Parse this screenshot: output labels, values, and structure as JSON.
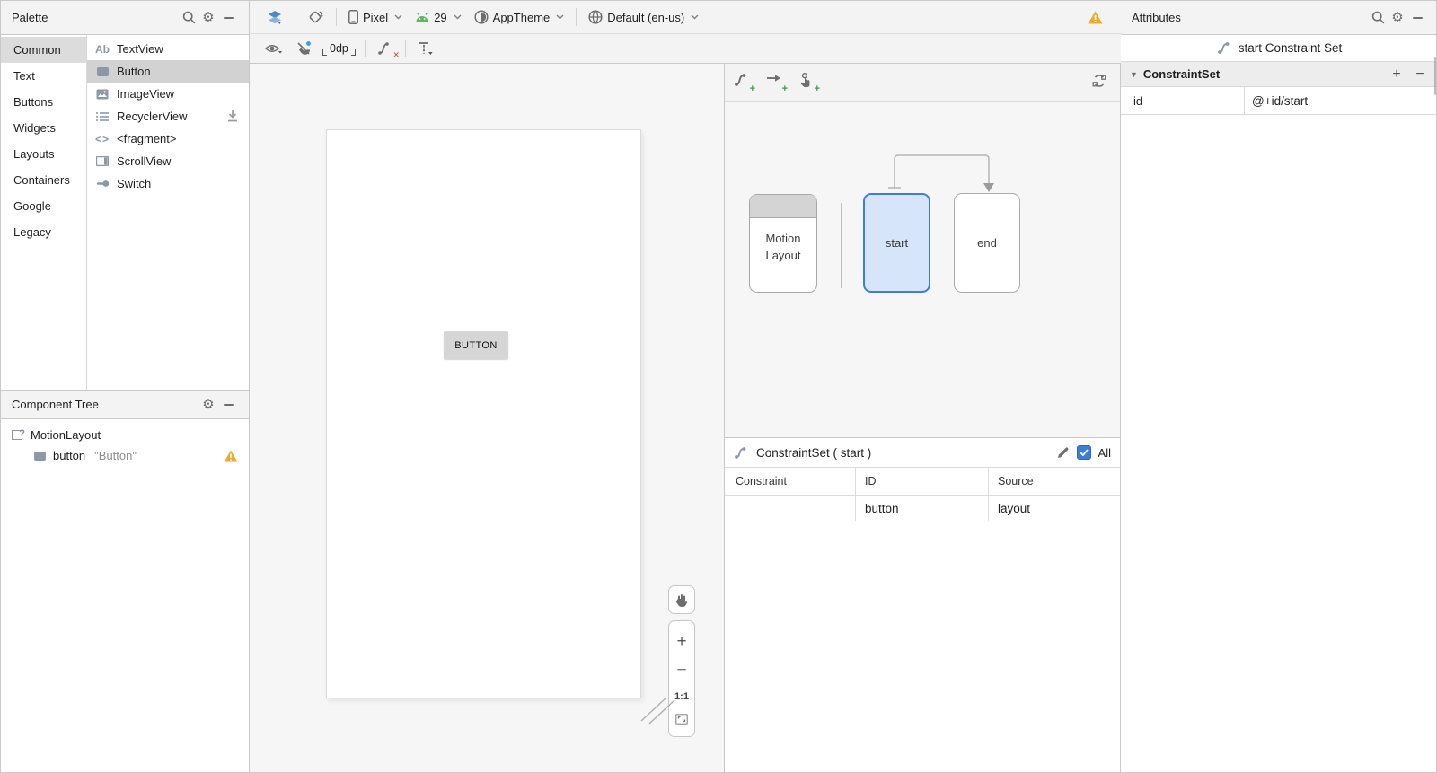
{
  "palette": {
    "title": "Palette",
    "categories": [
      {
        "label": "Common"
      },
      {
        "label": "Text"
      },
      {
        "label": "Buttons"
      },
      {
        "label": "Widgets"
      },
      {
        "label": "Layouts"
      },
      {
        "label": "Containers"
      },
      {
        "label": "Google"
      },
      {
        "label": "Legacy"
      }
    ],
    "items": [
      {
        "label": "TextView"
      },
      {
        "label": "Button"
      },
      {
        "label": "ImageView"
      },
      {
        "label": "RecyclerView"
      },
      {
        "label": "<fragment>"
      },
      {
        "label": "ScrollView"
      },
      {
        "label": "Switch"
      }
    ]
  },
  "component_tree": {
    "title": "Component Tree",
    "root_label": "MotionLayout",
    "child_label": "button",
    "child_value": "\"Button\""
  },
  "toolbar": {
    "device": "Pixel",
    "api_level": "29",
    "theme": "AppTheme",
    "locale": "Default (en-us)",
    "default_margin": "0dp"
  },
  "canvas": {
    "button_label": "BUTTON",
    "zoom_ratio": "1:1"
  },
  "motion_editor": {
    "motion_layout_line1": "Motion",
    "motion_layout_line2": "Layout",
    "start_label": "start",
    "end_label": "end",
    "constraint_set": {
      "title": "ConstraintSet ( start )",
      "all_label": "All",
      "columns": [
        "Constraint",
        "ID",
        "Source"
      ],
      "row": {
        "constraint": "",
        "id": "button",
        "source": "layout"
      }
    }
  },
  "attributes": {
    "title": "Attributes",
    "header": "start Constraint Set",
    "section_title": "ConstraintSet",
    "rows": [
      {
        "name": "id",
        "value": "@+id/start"
      }
    ]
  },
  "icons": {
    "gear_glyph": "⚙",
    "textview_glyph": "Ab",
    "fragment_glyph": "<>",
    "motionlayout_badge": "?",
    "expand_arrow": "▼",
    "plus_glyph": "+",
    "minus_glyph": "−",
    "zoom_in_glyph": "+",
    "zoom_out_glyph": "−",
    "add_badge": "+",
    "clear_badge": "✕"
  },
  "colors": {
    "accent_blue": "#3a7fe0",
    "selection_fill": "#d7e5fa",
    "android_green": "#5fb562",
    "warning_amber": "#f0a732",
    "checkbox_blue": "#3d7edb",
    "error_red": "#d6494f",
    "icon_gray": "#6e6e6e",
    "panel_chrome": "#f3f3f3"
  }
}
